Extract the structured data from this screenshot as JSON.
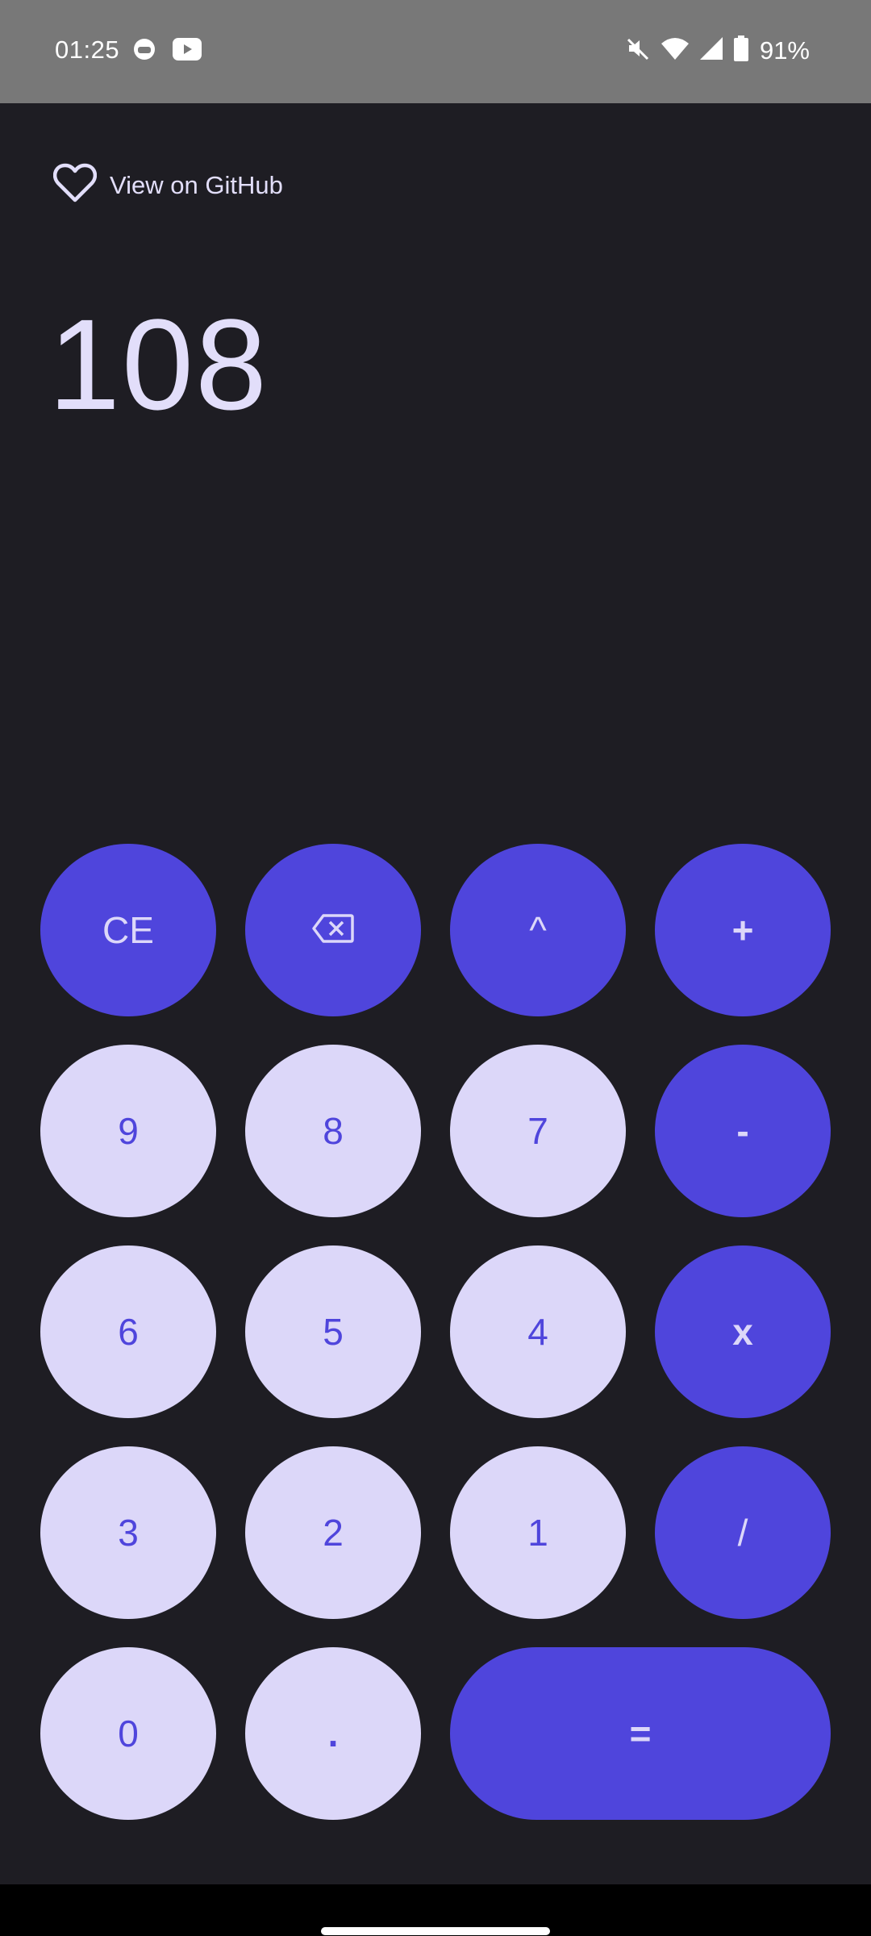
{
  "status_bar": {
    "time": "01:25",
    "battery": "91%",
    "icons": [
      "notification-face-icon",
      "youtube-icon",
      "mute-icon",
      "wifi-icon",
      "signal-icon",
      "battery-icon"
    ]
  },
  "header": {
    "github_label": "View on GitHub",
    "icon": "heart-icon"
  },
  "display": {
    "value": "108"
  },
  "keys": {
    "ce": "CE",
    "backspace": "backspace-icon",
    "power": "^",
    "plus": "+",
    "nine": "9",
    "eight": "8",
    "seven": "7",
    "minus": "-",
    "six": "6",
    "five": "5",
    "four": "4",
    "multiply": "x",
    "three": "3",
    "two": "2",
    "one": "1",
    "divide": "/",
    "zero": "0",
    "decimal": ".",
    "equals": "="
  },
  "colors": {
    "background": "#1e1d23",
    "operator_key": "#4f45dc",
    "number_key": "#dcd7f9",
    "text": "#e2defa"
  }
}
